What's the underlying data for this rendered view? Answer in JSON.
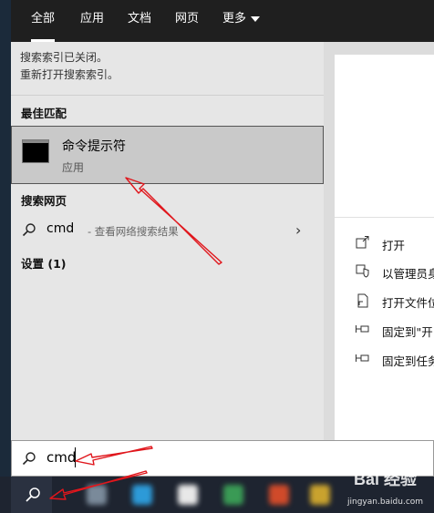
{
  "tabs": [
    {
      "label": "全部"
    },
    {
      "label": "应用"
    },
    {
      "label": "文档"
    },
    {
      "label": "网页"
    },
    {
      "label": "更多"
    }
  ],
  "notice": {
    "line1": "搜索索引已关闭。",
    "line2": "重新打开搜索索引。"
  },
  "best_match": {
    "header": "最佳匹配",
    "title": "命令提示符",
    "subtitle": "应用",
    "icon": "command-prompt-icon"
  },
  "web_search": {
    "header": "搜索网页",
    "query": "cmd",
    "hint": "- 查看网络搜索结果"
  },
  "settings": {
    "header": "设置 (1)"
  },
  "actions": [
    {
      "label": "打开",
      "icon": "open-icon"
    },
    {
      "label": "以管理员身",
      "icon": "shield-icon"
    },
    {
      "label": "打开文件位",
      "icon": "file-location-icon"
    },
    {
      "label": "固定到\"开",
      "icon": "pin-icon"
    },
    {
      "label": "固定到任务",
      "icon": "pin-icon"
    }
  ],
  "search": {
    "value": "cmd"
  },
  "watermark": {
    "logo": "Bai 经验",
    "url": "jingyan.baidu.com"
  },
  "colors": {
    "annotation_arrow": "#e0161c",
    "selected_bg": "#c9c9c9"
  }
}
